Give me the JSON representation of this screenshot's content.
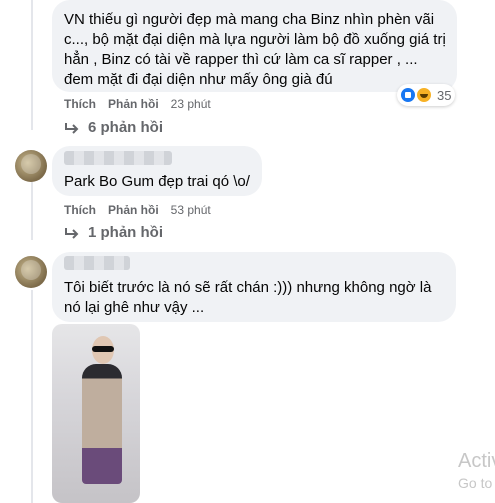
{
  "comments": [
    {
      "text": "VN thiếu gì người đẹp mà mang cha Binz nhìn phèn vãi c..., bộ mặt đại diện mà lựa người làm bộ đồ xuống giá trị hẳn , Binz có tài về rapper thì cứ làm ca sĩ rapper , ... đem mặt đi đại diện như mấy ông già đú",
      "like_label": "Thích",
      "reply_label": "Phản hồi",
      "time": "23 phút",
      "reaction_count": "35",
      "replies_label": "6 phản hồi"
    },
    {
      "text": "Park Bo Gum đẹp trai qó \\o/",
      "like_label": "Thích",
      "reply_label": "Phản hồi",
      "time": "53 phút",
      "replies_label": "1 phản hồi"
    },
    {
      "text": "Tôi biết trước là nó sẽ rất chán :))) nhưng không ngờ là nó lại ghê như vậy ..."
    }
  ],
  "watermark": {
    "line1": "Activ",
    "line2": "Go to"
  },
  "colors": {
    "bubble_bg": "#f0f2f5",
    "action_text": "#65676b",
    "like_blue": "#1877f2",
    "haha_yellow": "#f7b125"
  },
  "icons": [
    "reply-arrow-icon",
    "like-reaction-icon",
    "haha-reaction-icon"
  ]
}
